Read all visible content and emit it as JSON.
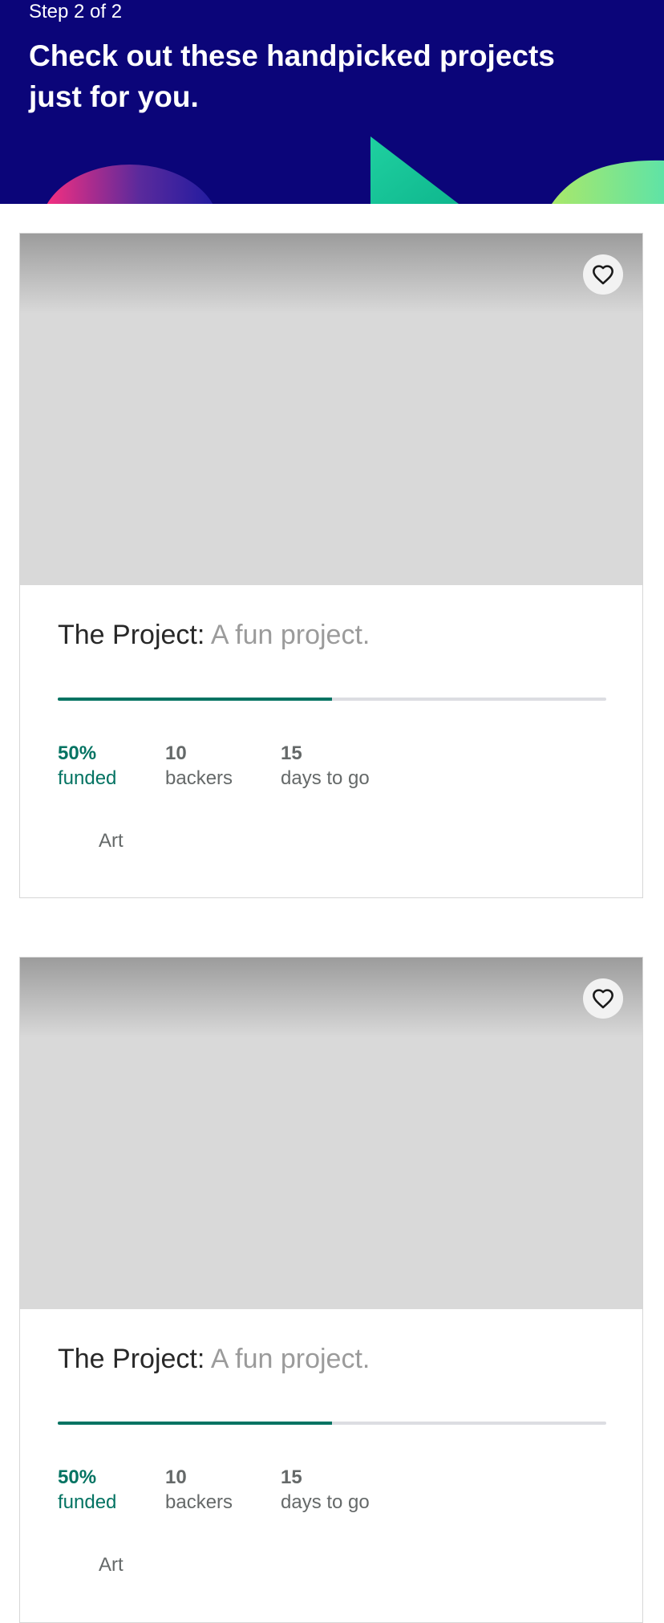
{
  "header": {
    "step": "Step 2 of 2",
    "headline": "Check out these handpicked projects just for you."
  },
  "colors": {
    "header_bg": "#0b0579",
    "accent_green": "#037362",
    "progress_track": "#dcdde2",
    "image_placeholder": "#d9d9d9"
  },
  "projects": [
    {
      "name": "The Project:",
      "blurb": "A fun project.",
      "percent_funded": 0.5,
      "funded_value": "50%",
      "funded_label": "funded",
      "backers_value": "10",
      "backers_label": "backers",
      "days_value": "15",
      "days_label": "days to go",
      "category": "Art",
      "save_icon": "heart-icon"
    },
    {
      "name": "The Project:",
      "blurb": "A fun project.",
      "percent_funded": 0.5,
      "funded_value": "50%",
      "funded_label": "funded",
      "backers_value": "10",
      "backers_label": "backers",
      "days_value": "15",
      "days_label": "days to go",
      "category": "Art",
      "save_icon": "heart-icon"
    }
  ]
}
